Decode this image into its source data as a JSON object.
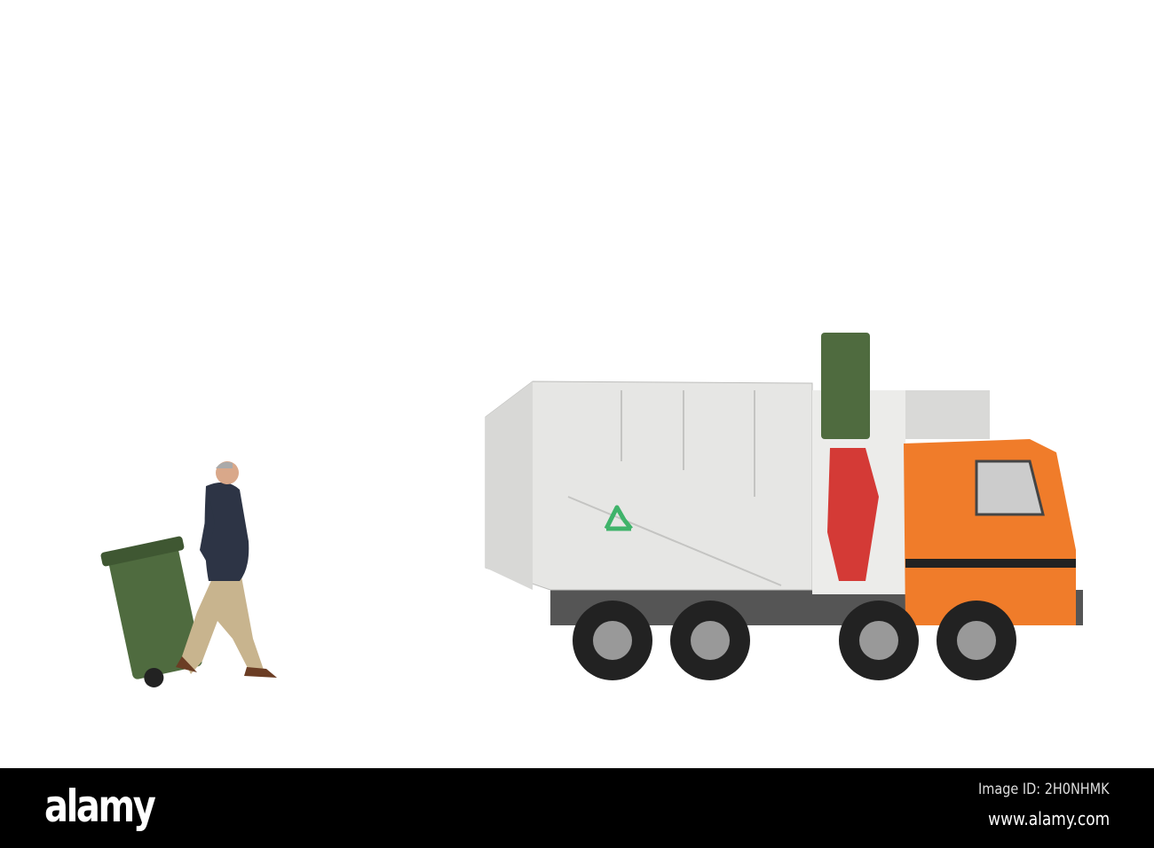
{
  "footer": {
    "logo": "alamy",
    "image_id": "Image ID: 2H0NHMK",
    "website": "www.alamy.com"
  },
  "colors": {
    "cab": "#f07c2a",
    "body": "#e4e4e2",
    "bin": "#4f6b3f",
    "arm": "#d43a36",
    "recycle": "#3fb36a"
  }
}
